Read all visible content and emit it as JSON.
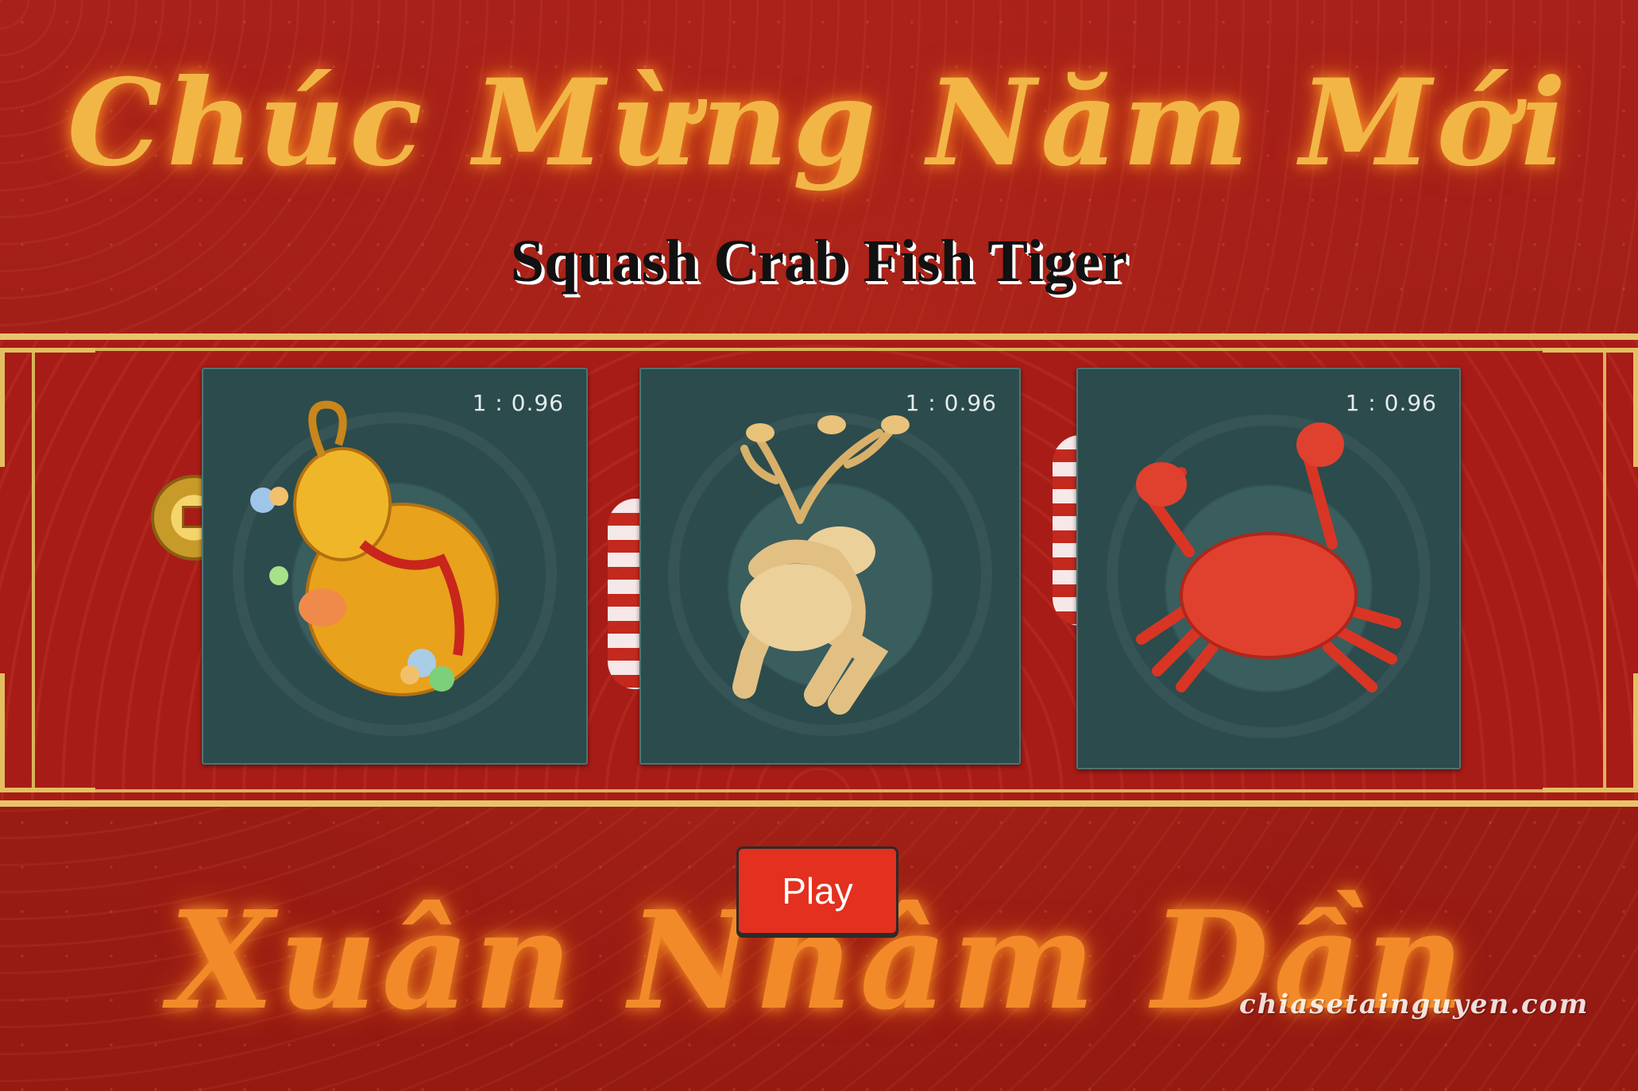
{
  "header": {
    "greeting": "Chúc Mừng Năm Mới",
    "title": "Squash Crab Fish Tiger"
  },
  "cards": [
    {
      "animal": "squash",
      "odds": "1 : 0.96"
    },
    {
      "animal": "deer",
      "odds": "1 : 0.96"
    },
    {
      "animal": "crab",
      "odds": "1 : 0.96"
    }
  ],
  "actions": {
    "play_label": "Play"
  },
  "footer": {
    "greeting": "Xuân Nhâm Dần",
    "watermark": "chiasetainguyen.com"
  },
  "colors": {
    "background": "#a81c17",
    "gold": "#e6c46a",
    "card": "#2c4b4c",
    "play_button": "#e3301f"
  }
}
